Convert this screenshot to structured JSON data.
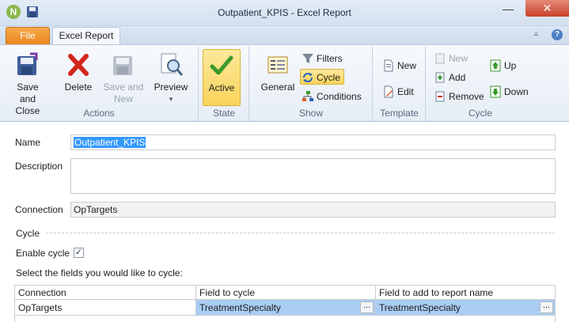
{
  "window": {
    "title": "Outpatient_KPIS - Excel Report",
    "minimize_glyph": "—",
    "close_glyph": "✕",
    "app_icon_letter": "N"
  },
  "tabs": {
    "file": "File",
    "active": "Excel Report",
    "collapse_glyph": "▵",
    "help_glyph": "?"
  },
  "ribbon": {
    "actions": {
      "label": "Actions",
      "save_close_line1": "Save and",
      "save_close_line2": "Close",
      "delete": "Delete",
      "save_new_line1": "Save and",
      "save_new_line2": "New",
      "preview": "Preview",
      "preview_arrow": "▾"
    },
    "state": {
      "label": "State",
      "active": "Active"
    },
    "show": {
      "label": "Show",
      "general": "General",
      "filters": "Filters",
      "cycle": "Cycle",
      "conditions": "Conditions"
    },
    "template": {
      "label": "Template",
      "new": "New",
      "edit": "Edit"
    },
    "cycle": {
      "label": "Cycle",
      "new": "New",
      "add": "Add",
      "remove": "Remove",
      "up": "Up",
      "down": "Down"
    }
  },
  "form": {
    "name_label": "Name",
    "name_value": "Outpatient_KPIS",
    "description_label": "Description",
    "description_value": "",
    "connection_label": "Connection",
    "connection_value": "OpTargets",
    "cycle_section": "Cycle",
    "enable_cycle_label": "Enable cycle",
    "enable_cycle_checked": true,
    "check_glyph": "✓",
    "fields_prompt": "Select the fields you would like to cycle:"
  },
  "grid": {
    "columns": [
      "Connection",
      "Field to cycle",
      "Field to add to report name"
    ],
    "rows": [
      [
        "OpTargets",
        "TreatmentSpecialty",
        "TreatmentSpecialty"
      ]
    ],
    "ellipsis": "..."
  },
  "colors": {
    "file_tab": "#e9861b",
    "active_state": "#f9d45c",
    "selection": "#3399ff",
    "close_button": "#c8412a"
  }
}
